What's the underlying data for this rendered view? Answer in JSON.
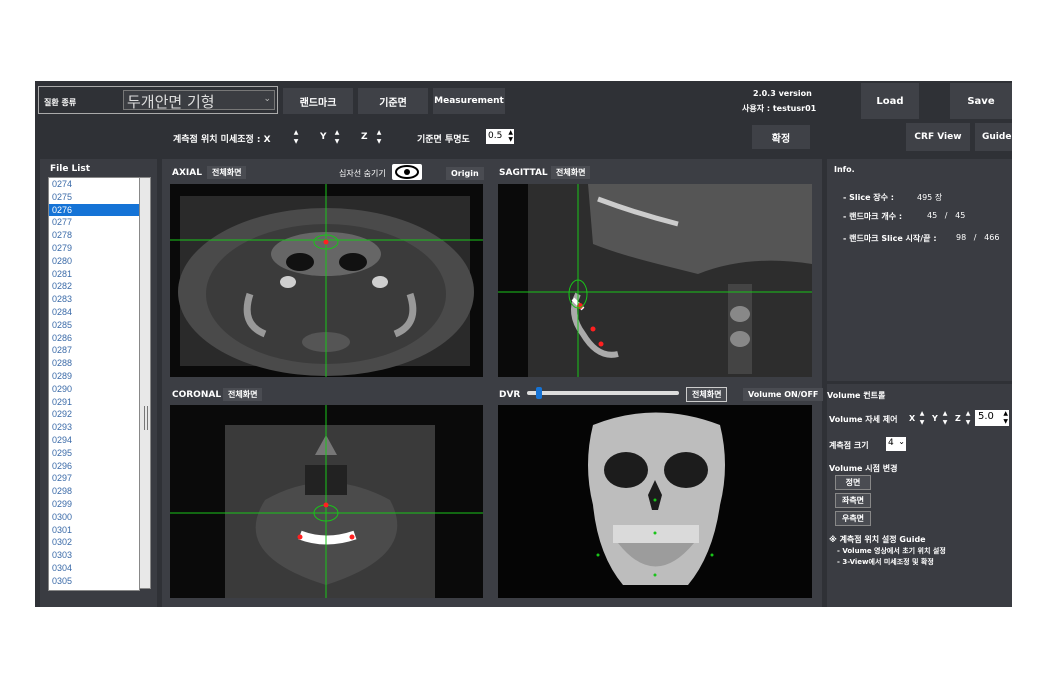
{
  "toolbar": {
    "category_label": "질환 종류",
    "category_value": "두개안면 기형",
    "landmark_btn": "랜드마크",
    "reference_btn": "기준면",
    "measurement_btn": "Measurement",
    "version": "2.0.3 version",
    "user": "사용자 : testusr01",
    "load_btn": "Load",
    "save_btn": "Save"
  },
  "adjust": {
    "label": "계측점 위치 미세조정 : X",
    "y_label": "Y",
    "z_label": "Z",
    "opacity_label": "기준면 투명도",
    "opacity_value": "0.5",
    "confirm_btn": "확정",
    "crf_btn": "CRF View",
    "guide_btn": "Guide"
  },
  "file_list": {
    "title": "File List",
    "selected": "0276",
    "items": [
      "0274",
      "0275",
      "0276",
      "0277",
      "0278",
      "0279",
      "0280",
      "0281",
      "0282",
      "0283",
      "0284",
      "0285",
      "0286",
      "0287",
      "0288",
      "0289",
      "0290",
      "0291",
      "0292",
      "0293",
      "0294",
      "0295",
      "0296",
      "0297",
      "0298",
      "0299",
      "0300",
      "0301",
      "0302",
      "0303",
      "0304",
      "0305"
    ]
  },
  "views": {
    "axial": {
      "title": "AXIAL",
      "fullscreen": "전체화면",
      "crosshair_toggle": "십자선 숨기기",
      "origin_btn": "Origin"
    },
    "sagittal": {
      "title": "SAGITTAL",
      "fullscreen": "전체화면"
    },
    "coronal": {
      "title": "CORONAL",
      "fullscreen": "전체화면"
    },
    "dvr": {
      "title": "DVR",
      "fullscreen": "전체화면",
      "volume_toggle": "Volume ON/OFF",
      "slider_value": 0.06
    }
  },
  "info": {
    "title": "Info.",
    "slice_label": "- Slice 장수 :",
    "slice_value": "495 장",
    "landmark_label": "- 랜드마크 개수 :",
    "landmark_value": "45   /   45",
    "range_label": "- 랜드마크 Slice 시작/끝 :",
    "range_value": "98   /   466"
  },
  "volume": {
    "title": "Volume 컨트롤",
    "pose_label": "Volume 자세 제어",
    "x": "X",
    "y": "Y",
    "z": "Z",
    "step_value": "5.0",
    "point_size_label": "계측점 크기",
    "point_size_value": "4",
    "view_change_label": "Volume 시점 변경",
    "front_btn": "정면",
    "left_btn": "좌측면",
    "right_btn": "우측면",
    "guide_title": "※ 계측점 위치 설정 Guide",
    "guide_line1": "- Volume 영상에서 초기 위치 설정",
    "guide_line2": "- 3-View에서 미세조정 및 확정"
  },
  "colors": {
    "crosshair": "#19c419",
    "landmark": "#ff2020",
    "selection": "#1573d6"
  }
}
